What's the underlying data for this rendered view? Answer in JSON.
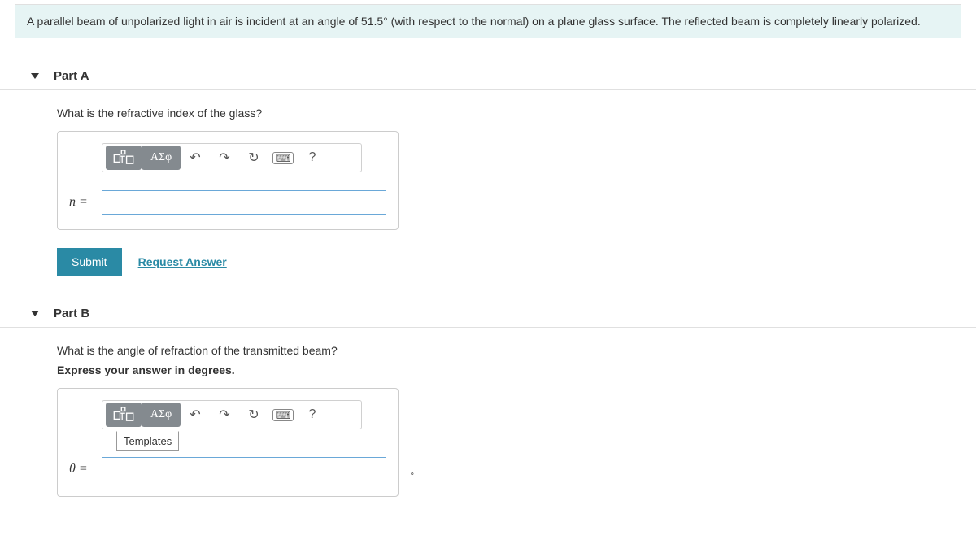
{
  "problem": {
    "intro": "A parallel beam of unpolarized light in air is incident at an angle of 51.5° (with respect to the normal) on a plane glass surface. The reflected beam is completely linearly polarized."
  },
  "partA": {
    "label": "Part A",
    "question": "What is the refractive index of the glass?",
    "var_label": "n =",
    "toolbar": {
      "greek": "ΑΣφ",
      "help": "?"
    },
    "submit": "Submit",
    "request": "Request Answer"
  },
  "partB": {
    "label": "Part B",
    "question": "What is the angle of refraction of the transmitted beam?",
    "hint": "Express your answer in degrees.",
    "var_label": "θ =",
    "unit": "°",
    "toolbar": {
      "greek": "ΑΣφ",
      "help": "?"
    },
    "templates_label": "Templates"
  }
}
